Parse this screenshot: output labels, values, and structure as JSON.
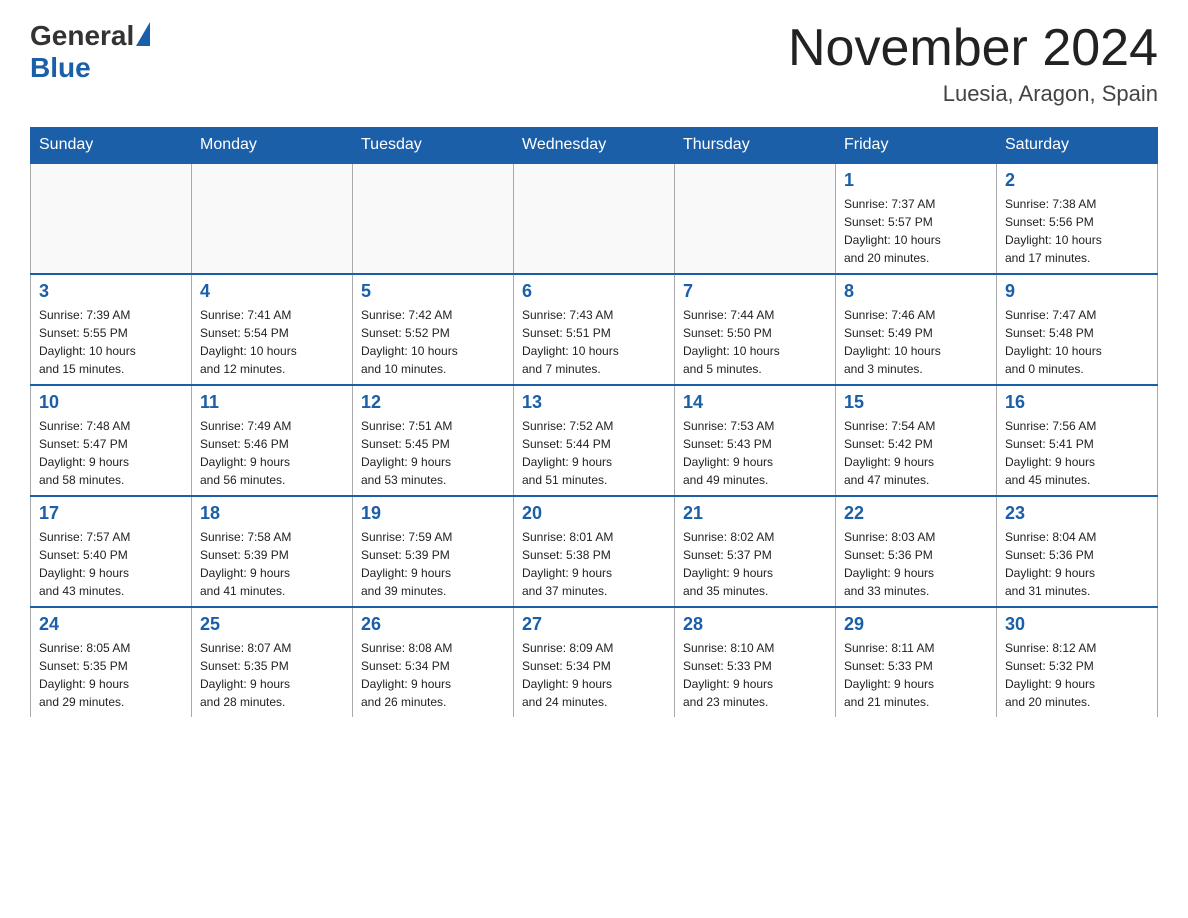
{
  "logo": {
    "general": "General",
    "blue": "Blue"
  },
  "title": "November 2024",
  "location": "Luesia, Aragon, Spain",
  "weekdays": [
    "Sunday",
    "Monday",
    "Tuesday",
    "Wednesday",
    "Thursday",
    "Friday",
    "Saturday"
  ],
  "weeks": [
    [
      {
        "day": "",
        "info": ""
      },
      {
        "day": "",
        "info": ""
      },
      {
        "day": "",
        "info": ""
      },
      {
        "day": "",
        "info": ""
      },
      {
        "day": "",
        "info": ""
      },
      {
        "day": "1",
        "info": "Sunrise: 7:37 AM\nSunset: 5:57 PM\nDaylight: 10 hours\nand 20 minutes."
      },
      {
        "day": "2",
        "info": "Sunrise: 7:38 AM\nSunset: 5:56 PM\nDaylight: 10 hours\nand 17 minutes."
      }
    ],
    [
      {
        "day": "3",
        "info": "Sunrise: 7:39 AM\nSunset: 5:55 PM\nDaylight: 10 hours\nand 15 minutes."
      },
      {
        "day": "4",
        "info": "Sunrise: 7:41 AM\nSunset: 5:54 PM\nDaylight: 10 hours\nand 12 minutes."
      },
      {
        "day": "5",
        "info": "Sunrise: 7:42 AM\nSunset: 5:52 PM\nDaylight: 10 hours\nand 10 minutes."
      },
      {
        "day": "6",
        "info": "Sunrise: 7:43 AM\nSunset: 5:51 PM\nDaylight: 10 hours\nand 7 minutes."
      },
      {
        "day": "7",
        "info": "Sunrise: 7:44 AM\nSunset: 5:50 PM\nDaylight: 10 hours\nand 5 minutes."
      },
      {
        "day": "8",
        "info": "Sunrise: 7:46 AM\nSunset: 5:49 PM\nDaylight: 10 hours\nand 3 minutes."
      },
      {
        "day": "9",
        "info": "Sunrise: 7:47 AM\nSunset: 5:48 PM\nDaylight: 10 hours\nand 0 minutes."
      }
    ],
    [
      {
        "day": "10",
        "info": "Sunrise: 7:48 AM\nSunset: 5:47 PM\nDaylight: 9 hours\nand 58 minutes."
      },
      {
        "day": "11",
        "info": "Sunrise: 7:49 AM\nSunset: 5:46 PM\nDaylight: 9 hours\nand 56 minutes."
      },
      {
        "day": "12",
        "info": "Sunrise: 7:51 AM\nSunset: 5:45 PM\nDaylight: 9 hours\nand 53 minutes."
      },
      {
        "day": "13",
        "info": "Sunrise: 7:52 AM\nSunset: 5:44 PM\nDaylight: 9 hours\nand 51 minutes."
      },
      {
        "day": "14",
        "info": "Sunrise: 7:53 AM\nSunset: 5:43 PM\nDaylight: 9 hours\nand 49 minutes."
      },
      {
        "day": "15",
        "info": "Sunrise: 7:54 AM\nSunset: 5:42 PM\nDaylight: 9 hours\nand 47 minutes."
      },
      {
        "day": "16",
        "info": "Sunrise: 7:56 AM\nSunset: 5:41 PM\nDaylight: 9 hours\nand 45 minutes."
      }
    ],
    [
      {
        "day": "17",
        "info": "Sunrise: 7:57 AM\nSunset: 5:40 PM\nDaylight: 9 hours\nand 43 minutes."
      },
      {
        "day": "18",
        "info": "Sunrise: 7:58 AM\nSunset: 5:39 PM\nDaylight: 9 hours\nand 41 minutes."
      },
      {
        "day": "19",
        "info": "Sunrise: 7:59 AM\nSunset: 5:39 PM\nDaylight: 9 hours\nand 39 minutes."
      },
      {
        "day": "20",
        "info": "Sunrise: 8:01 AM\nSunset: 5:38 PM\nDaylight: 9 hours\nand 37 minutes."
      },
      {
        "day": "21",
        "info": "Sunrise: 8:02 AM\nSunset: 5:37 PM\nDaylight: 9 hours\nand 35 minutes."
      },
      {
        "day": "22",
        "info": "Sunrise: 8:03 AM\nSunset: 5:36 PM\nDaylight: 9 hours\nand 33 minutes."
      },
      {
        "day": "23",
        "info": "Sunrise: 8:04 AM\nSunset: 5:36 PM\nDaylight: 9 hours\nand 31 minutes."
      }
    ],
    [
      {
        "day": "24",
        "info": "Sunrise: 8:05 AM\nSunset: 5:35 PM\nDaylight: 9 hours\nand 29 minutes."
      },
      {
        "day": "25",
        "info": "Sunrise: 8:07 AM\nSunset: 5:35 PM\nDaylight: 9 hours\nand 28 minutes."
      },
      {
        "day": "26",
        "info": "Sunrise: 8:08 AM\nSunset: 5:34 PM\nDaylight: 9 hours\nand 26 minutes."
      },
      {
        "day": "27",
        "info": "Sunrise: 8:09 AM\nSunset: 5:34 PM\nDaylight: 9 hours\nand 24 minutes."
      },
      {
        "day": "28",
        "info": "Sunrise: 8:10 AM\nSunset: 5:33 PM\nDaylight: 9 hours\nand 23 minutes."
      },
      {
        "day": "29",
        "info": "Sunrise: 8:11 AM\nSunset: 5:33 PM\nDaylight: 9 hours\nand 21 minutes."
      },
      {
        "day": "30",
        "info": "Sunrise: 8:12 AM\nSunset: 5:32 PM\nDaylight: 9 hours\nand 20 minutes."
      }
    ]
  ]
}
